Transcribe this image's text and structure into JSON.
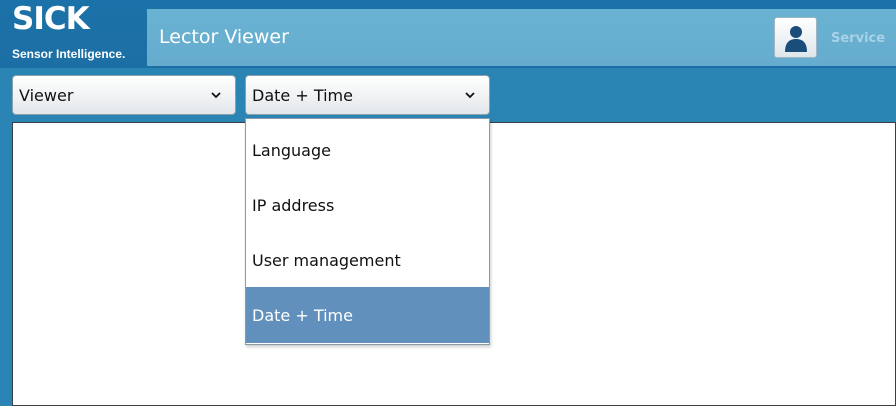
{
  "brand": {
    "name": "SICK",
    "tagline": "Sensor Intelligence."
  },
  "header": {
    "title": "Lector Viewer",
    "user_role": "Service",
    "user_icon": "user-icon"
  },
  "nav": {
    "view_select": {
      "value": "Viewer"
    },
    "settings_select": {
      "value": "Date + Time",
      "options": [
        "Language",
        "IP address",
        "User management",
        "Date + Time"
      ],
      "selected_index": 3
    }
  },
  "colors": {
    "background": "#2a84b4",
    "titlebar": "#6ab2d2",
    "selected_option": "#6290bd"
  }
}
